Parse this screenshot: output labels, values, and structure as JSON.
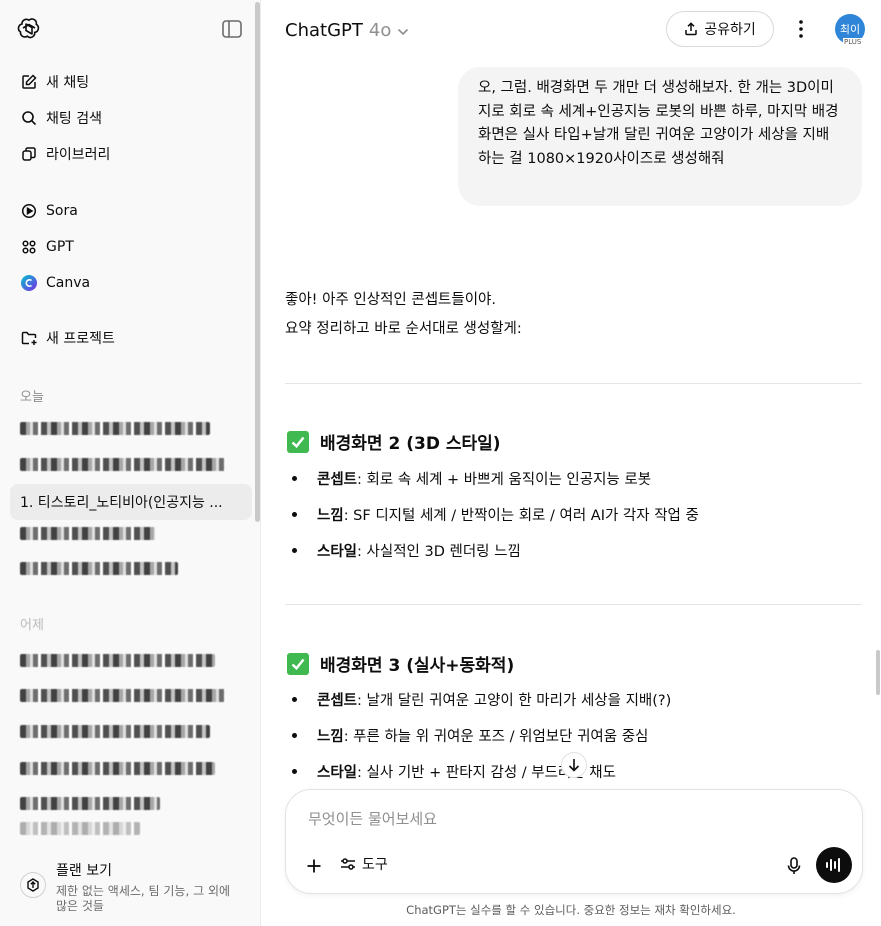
{
  "sidebar": {
    "nav": [
      {
        "label": "새 채팅",
        "icon": "edit-icon"
      },
      {
        "label": "채팅 검색",
        "icon": "search-icon"
      },
      {
        "label": "라이브러리",
        "icon": "library-icon"
      }
    ],
    "apps": [
      {
        "label": "Sora",
        "icon": "sora-icon"
      },
      {
        "label": "GPT",
        "icon": "gpt-grid-icon"
      },
      {
        "label": "Canva",
        "icon": "canva-icon"
      }
    ],
    "new_project": "새 프로젝트",
    "section_today": "오늘",
    "active_chat": "1. 티스토리_노티비아(인공지능 ...",
    "section_yesterday": "어제",
    "footer": {
      "title": "플랜 보기",
      "subtitle": "제한 없는 액세스, 팀 기능, 그 외에 많은 것들"
    }
  },
  "header": {
    "model_name": "ChatGPT",
    "model_version": "4o",
    "share_label": "공유하기",
    "avatar_text": "최이",
    "plan_badge": "PLUS"
  },
  "conversation": {
    "user_message": "오, 그럼. 배경화면 두 개만 더 생성해보자. 한 개는 3D이미지로 회로 속 세계+인공지능 로봇의 바쁜 하루, 마지막 배경화면은 실사 타입+날개 달린 귀여운 고양이가 세상을 지배하는 걸 1080×1920사이즈로 생성해줘",
    "assistant_intro_1": "좋아! 아주 인상적인 콘셉트들이야.",
    "assistant_intro_2": "요약 정리하고 바로 순서대로 생성할게:",
    "sections": [
      {
        "title": "배경화면 2 (3D 스타일)",
        "items": [
          {
            "key": "콘셉트",
            "value": ": 회로 속 세계 + 바쁘게 움직이는 인공지능 로봇"
          },
          {
            "key": "느낌",
            "value": ": SF 디지털 세계 / 반짝이는 회로 / 여러 AI가 각자 작업 중"
          },
          {
            "key": "스타일",
            "value": ": 사실적인 3D 렌더링 느낌"
          }
        ]
      },
      {
        "title": "배경화면 3 (실사+동화적)",
        "items": [
          {
            "key": "콘셉트",
            "value": ": 날개 달린 귀여운 고양이 한 마리가 세상을 지배(?)"
          },
          {
            "key": "느낌",
            "value": ": 푸른 하늘 위 귀여운 포즈 / 위엄보단 귀여움 중심"
          },
          {
            "key": "스타일",
            "value": ": 실사 기반 + 판타지 감성 / 부드러운 채도"
          }
        ]
      }
    ]
  },
  "composer": {
    "placeholder": "무엇이든 물어보세요",
    "tools_label": "도구"
  },
  "disclaimer": "ChatGPT는 실수를 할 수 있습니다. 중요한 정보는 재차 확인하세요.",
  "colors": {
    "sidebar_bg": "#f9f9f9",
    "bubble_bg": "#f4f4f4",
    "check_green": "#3fb950",
    "avatar_blue": "#2f86d8"
  }
}
